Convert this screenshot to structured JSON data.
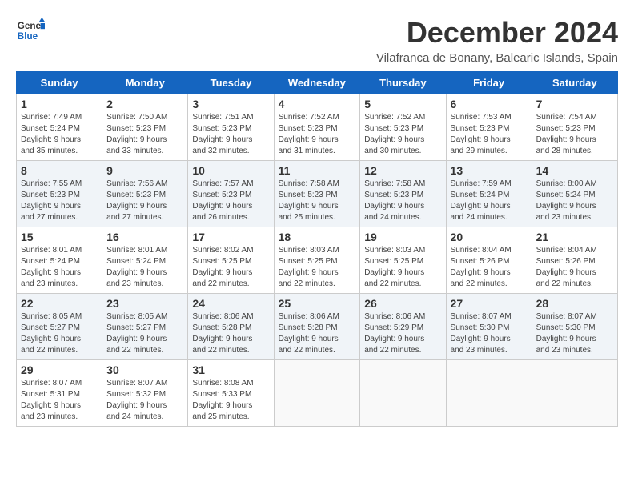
{
  "logo": {
    "line1": "General",
    "line2": "Blue"
  },
  "title": {
    "month_year": "December 2024",
    "location": "Vilafranca de Bonany, Balearic Islands, Spain"
  },
  "headers": [
    "Sunday",
    "Monday",
    "Tuesday",
    "Wednesday",
    "Thursday",
    "Friday",
    "Saturday"
  ],
  "weeks": [
    [
      {
        "day": "1",
        "info": "Sunrise: 7:49 AM\nSunset: 5:24 PM\nDaylight: 9 hours\nand 35 minutes."
      },
      {
        "day": "2",
        "info": "Sunrise: 7:50 AM\nSunset: 5:23 PM\nDaylight: 9 hours\nand 33 minutes."
      },
      {
        "day": "3",
        "info": "Sunrise: 7:51 AM\nSunset: 5:23 PM\nDaylight: 9 hours\nand 32 minutes."
      },
      {
        "day": "4",
        "info": "Sunrise: 7:52 AM\nSunset: 5:23 PM\nDaylight: 9 hours\nand 31 minutes."
      },
      {
        "day": "5",
        "info": "Sunrise: 7:52 AM\nSunset: 5:23 PM\nDaylight: 9 hours\nand 30 minutes."
      },
      {
        "day": "6",
        "info": "Sunrise: 7:53 AM\nSunset: 5:23 PM\nDaylight: 9 hours\nand 29 minutes."
      },
      {
        "day": "7",
        "info": "Sunrise: 7:54 AM\nSunset: 5:23 PM\nDaylight: 9 hours\nand 28 minutes."
      }
    ],
    [
      {
        "day": "8",
        "info": "Sunrise: 7:55 AM\nSunset: 5:23 PM\nDaylight: 9 hours\nand 27 minutes."
      },
      {
        "day": "9",
        "info": "Sunrise: 7:56 AM\nSunset: 5:23 PM\nDaylight: 9 hours\nand 27 minutes."
      },
      {
        "day": "10",
        "info": "Sunrise: 7:57 AM\nSunset: 5:23 PM\nDaylight: 9 hours\nand 26 minutes."
      },
      {
        "day": "11",
        "info": "Sunrise: 7:58 AM\nSunset: 5:23 PM\nDaylight: 9 hours\nand 25 minutes."
      },
      {
        "day": "12",
        "info": "Sunrise: 7:58 AM\nSunset: 5:23 PM\nDaylight: 9 hours\nand 24 minutes."
      },
      {
        "day": "13",
        "info": "Sunrise: 7:59 AM\nSunset: 5:24 PM\nDaylight: 9 hours\nand 24 minutes."
      },
      {
        "day": "14",
        "info": "Sunrise: 8:00 AM\nSunset: 5:24 PM\nDaylight: 9 hours\nand 23 minutes."
      }
    ],
    [
      {
        "day": "15",
        "info": "Sunrise: 8:01 AM\nSunset: 5:24 PM\nDaylight: 9 hours\nand 23 minutes."
      },
      {
        "day": "16",
        "info": "Sunrise: 8:01 AM\nSunset: 5:24 PM\nDaylight: 9 hours\nand 23 minutes."
      },
      {
        "day": "17",
        "info": "Sunrise: 8:02 AM\nSunset: 5:25 PM\nDaylight: 9 hours\nand 22 minutes."
      },
      {
        "day": "18",
        "info": "Sunrise: 8:03 AM\nSunset: 5:25 PM\nDaylight: 9 hours\nand 22 minutes."
      },
      {
        "day": "19",
        "info": "Sunrise: 8:03 AM\nSunset: 5:25 PM\nDaylight: 9 hours\nand 22 minutes."
      },
      {
        "day": "20",
        "info": "Sunrise: 8:04 AM\nSunset: 5:26 PM\nDaylight: 9 hours\nand 22 minutes."
      },
      {
        "day": "21",
        "info": "Sunrise: 8:04 AM\nSunset: 5:26 PM\nDaylight: 9 hours\nand 22 minutes."
      }
    ],
    [
      {
        "day": "22",
        "info": "Sunrise: 8:05 AM\nSunset: 5:27 PM\nDaylight: 9 hours\nand 22 minutes."
      },
      {
        "day": "23",
        "info": "Sunrise: 8:05 AM\nSunset: 5:27 PM\nDaylight: 9 hours\nand 22 minutes."
      },
      {
        "day": "24",
        "info": "Sunrise: 8:06 AM\nSunset: 5:28 PM\nDaylight: 9 hours\nand 22 minutes."
      },
      {
        "day": "25",
        "info": "Sunrise: 8:06 AM\nSunset: 5:28 PM\nDaylight: 9 hours\nand 22 minutes."
      },
      {
        "day": "26",
        "info": "Sunrise: 8:06 AM\nSunset: 5:29 PM\nDaylight: 9 hours\nand 22 minutes."
      },
      {
        "day": "27",
        "info": "Sunrise: 8:07 AM\nSunset: 5:30 PM\nDaylight: 9 hours\nand 23 minutes."
      },
      {
        "day": "28",
        "info": "Sunrise: 8:07 AM\nSunset: 5:30 PM\nDaylight: 9 hours\nand 23 minutes."
      }
    ],
    [
      {
        "day": "29",
        "info": "Sunrise: 8:07 AM\nSunset: 5:31 PM\nDaylight: 9 hours\nand 23 minutes."
      },
      {
        "day": "30",
        "info": "Sunrise: 8:07 AM\nSunset: 5:32 PM\nDaylight: 9 hours\nand 24 minutes."
      },
      {
        "day": "31",
        "info": "Sunrise: 8:08 AM\nSunset: 5:33 PM\nDaylight: 9 hours\nand 25 minutes."
      },
      {
        "day": "",
        "info": ""
      },
      {
        "day": "",
        "info": ""
      },
      {
        "day": "",
        "info": ""
      },
      {
        "day": "",
        "info": ""
      }
    ]
  ]
}
